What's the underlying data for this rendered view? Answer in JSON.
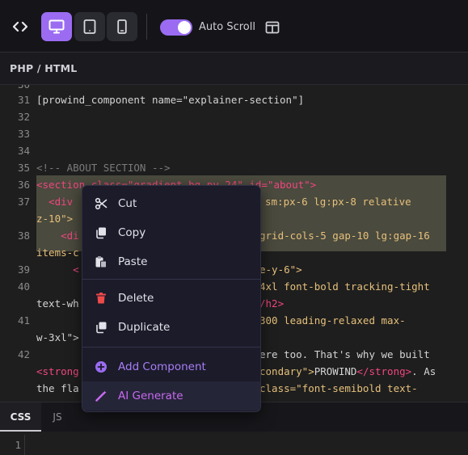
{
  "toolbar": {
    "code_toggle_icon": "code-brackets-icon",
    "device_buttons": [
      {
        "name": "desktop",
        "icon": "monitor-icon",
        "active": true
      },
      {
        "name": "tablet",
        "icon": "tablet-icon",
        "active": false
      },
      {
        "name": "mobile",
        "icon": "phone-icon",
        "active": false
      }
    ],
    "auto_scroll_label": "Auto Scroll",
    "auto_scroll_enabled": true,
    "layout_icon": "split-layout-icon",
    "accent_color": "#9b6cf2"
  },
  "section": {
    "title": "PHP / HTML"
  },
  "editor": {
    "line_numbers": [
      "30",
      "31",
      "32",
      "33",
      "34",
      "35",
      "36",
      "37",
      "38",
      "39",
      "40",
      "41",
      "42"
    ],
    "lines": [
      "",
      "[prowind_component name=\"explainer-section\"]",
      "",
      "",
      "",
      "<!-- ABOUT SECTION -->",
      "<section class=\"gradient-bg py-24\" id=\"about\">",
      "  <div",
      "z-10\">",
      "    <di",
      "items-c",
      "      <",
      "",
      "text-wh",
      "",
      "w-3xl\">",
      "",
      "<strong",
      "the fla"
    ],
    "right_fragments": {
      "l37": "sm:px-6 lg:px-8 relative",
      "l38": "grid-cols-5 gap-10 lg:gap-16",
      "l39": "e-y-6\">",
      "l40a": "4xl font-bold tracking-tight",
      "l40b": "/h2>",
      "l41a": "300 leading-relaxed max-",
      "l42a": "ere too. That's why we built",
      "l42b_str": "condary\">",
      "l42b_txt": "PROWIND",
      "l42b_close": "</strong>",
      "l42b_end": ". As",
      "l42c": "class=\"font-semibold text-"
    }
  },
  "context_menu": {
    "items": [
      {
        "label": "Cut",
        "icon": "scissors-icon",
        "color": "#e2e2ea"
      },
      {
        "label": "Copy",
        "icon": "copy-icon",
        "color": "#e2e2ea"
      },
      {
        "label": "Paste",
        "icon": "clipboard-icon",
        "color": "#e2e2ea"
      },
      {
        "label": "Delete",
        "icon": "trash-icon",
        "color": "#e2e2ea"
      },
      {
        "label": "Duplicate",
        "icon": "duplicate-icon",
        "color": "#e2e2ea"
      },
      {
        "label": "Add Component",
        "icon": "add-circle-icon",
        "color": "#a87ef5"
      },
      {
        "label": "AI Generate",
        "icon": "magic-wand-icon",
        "color": "#c86af0"
      }
    ]
  },
  "bottom_tabs": [
    {
      "label": "CSS",
      "active": true
    },
    {
      "label": "JS",
      "active": false
    }
  ],
  "css_editor": {
    "line_number": "1"
  }
}
